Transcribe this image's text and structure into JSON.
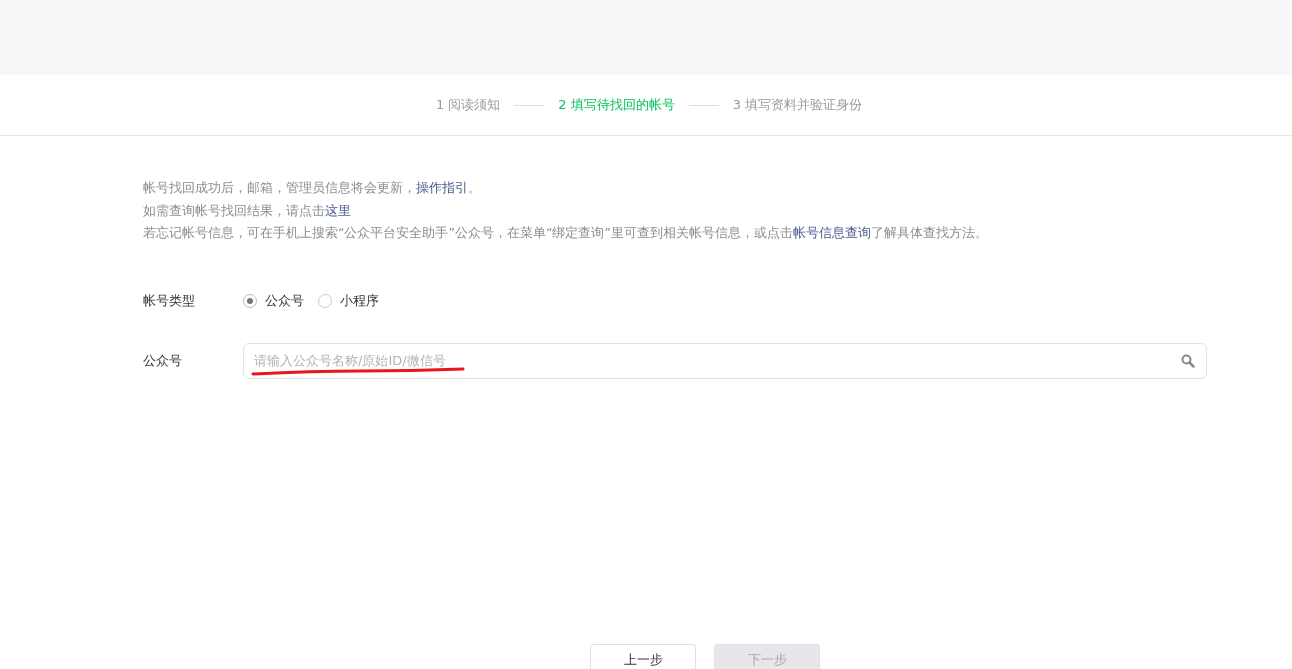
{
  "steps": [
    {
      "label": "1 阅读须知",
      "selected": false
    },
    {
      "label": "2 填写待找回的帐号",
      "selected": true
    },
    {
      "label": "3 填写资料并验证身份",
      "selected": false
    }
  ],
  "notices": [
    [
      {
        "kind": "plain",
        "text": "帐号找回成功后，邮箱，管理员信息将会更新，"
      },
      {
        "kind": "link",
        "text": "操作指引"
      },
      {
        "kind": "plain",
        "text": "。"
      }
    ],
    [
      {
        "kind": "plain",
        "text": "如需查询帐号找回结果，请点击"
      },
      {
        "kind": "link",
        "text": "这里"
      }
    ],
    [
      {
        "kind": "plain",
        "text": "若忘记帐号信息，可在手机上搜索“公众平台安全助手”公众号，在菜单“绑定查询”里可查到相关帐号信息，或点击"
      },
      {
        "kind": "link",
        "text": "帐号信息查询"
      },
      {
        "kind": "plain",
        "text": "了解具体查找方法。"
      }
    ]
  ],
  "account_type": {
    "label": "帐号类型",
    "options": [
      {
        "label": "公众号",
        "selected": true
      },
      {
        "label": "小程序",
        "selected": false
      }
    ]
  },
  "account_field": {
    "label": "公众号",
    "placeholder": "请输入公众号名称/原始ID/微信号"
  },
  "buttons": [
    {
      "label": "上一步",
      "disabled": false
    },
    {
      "label": "下一步",
      "disabled": true
    }
  ]
}
